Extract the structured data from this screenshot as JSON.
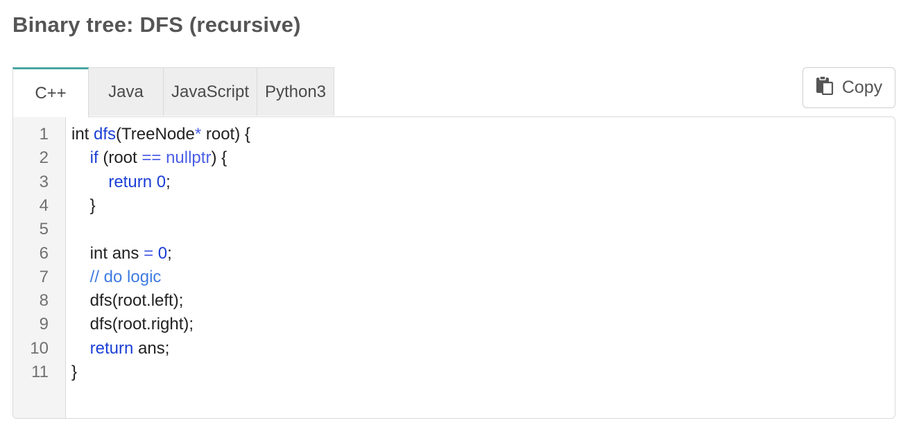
{
  "page": {
    "title": "Binary tree: DFS (recursive)"
  },
  "tabs": [
    {
      "label": "C++",
      "active": true
    },
    {
      "label": "Java",
      "active": false
    },
    {
      "label": "JavaScript",
      "active": false
    },
    {
      "label": "Python3",
      "active": false
    }
  ],
  "copy_button": {
    "label": "Copy",
    "icon": "clipboard-icon"
  },
  "editor": {
    "line_numbers": [
      "1",
      "2",
      "3",
      "4",
      "5",
      "6",
      "7",
      "8",
      "9",
      "10",
      "11"
    ],
    "lines": [
      [
        {
          "t": "int ",
          "c": "plain"
        },
        {
          "t": "dfs",
          "c": "fn"
        },
        {
          "t": "(TreeNode",
          "c": "plain"
        },
        {
          "t": "*",
          "c": "op"
        },
        {
          "t": " root) {",
          "c": "plain"
        }
      ],
      [
        {
          "t": "    ",
          "c": "plain"
        },
        {
          "t": "if",
          "c": "kw"
        },
        {
          "t": " (root ",
          "c": "plain"
        },
        {
          "t": "==",
          "c": "op"
        },
        {
          "t": " ",
          "c": "plain"
        },
        {
          "t": "nullptr",
          "c": "lit"
        },
        {
          "t": ") {",
          "c": "plain"
        }
      ],
      [
        {
          "t": "        ",
          "c": "plain"
        },
        {
          "t": "return",
          "c": "kw"
        },
        {
          "t": " ",
          "c": "plain"
        },
        {
          "t": "0",
          "c": "num"
        },
        {
          "t": ";",
          "c": "plain"
        }
      ],
      [
        {
          "t": "    }",
          "c": "plain"
        }
      ],
      [
        {
          "t": "",
          "c": "plain"
        }
      ],
      [
        {
          "t": "    int ans ",
          "c": "plain"
        },
        {
          "t": "=",
          "c": "op"
        },
        {
          "t": " ",
          "c": "plain"
        },
        {
          "t": "0",
          "c": "num"
        },
        {
          "t": ";",
          "c": "plain"
        }
      ],
      [
        {
          "t": "    ",
          "c": "plain"
        },
        {
          "t": "// do logic",
          "c": "cm"
        }
      ],
      [
        {
          "t": "    dfs(root.left);",
          "c": "plain"
        }
      ],
      [
        {
          "t": "    dfs(root.right);",
          "c": "plain"
        }
      ],
      [
        {
          "t": "    ",
          "c": "plain"
        },
        {
          "t": "return",
          "c": "kw"
        },
        {
          "t": " ans;",
          "c": "plain"
        }
      ],
      [
        {
          "t": "}",
          "c": "plain"
        }
      ]
    ]
  }
}
